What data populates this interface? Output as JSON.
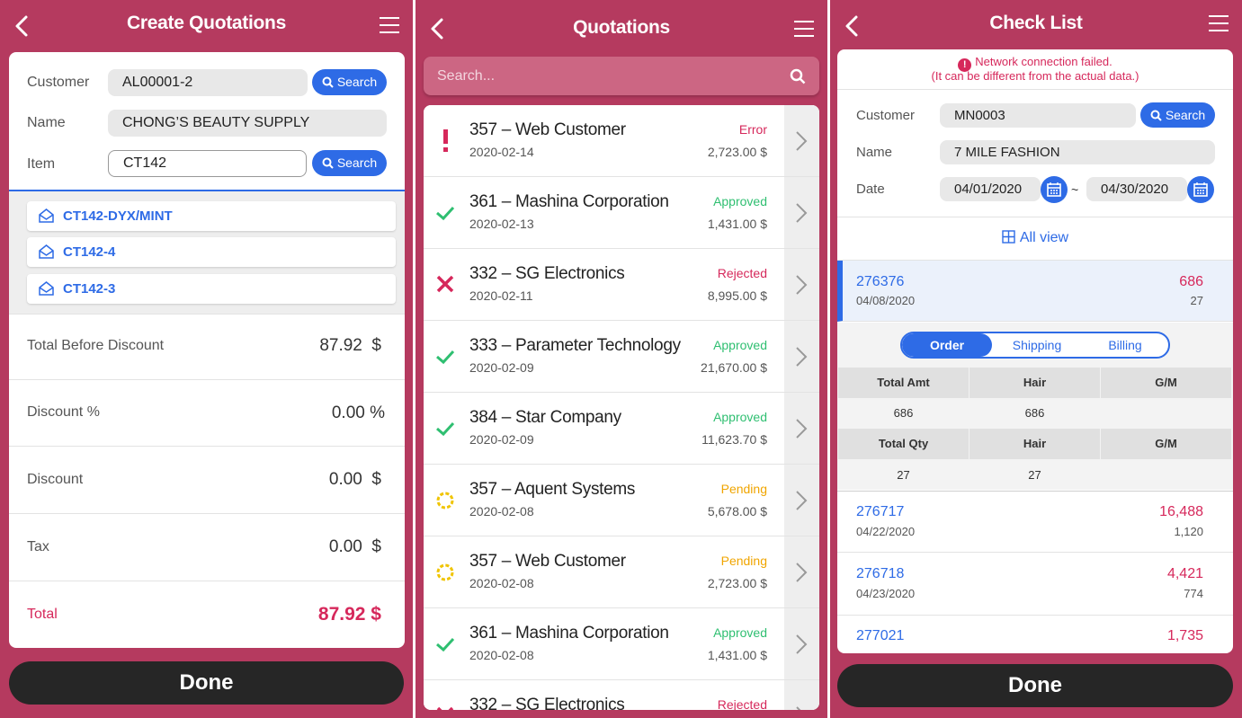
{
  "panel1": {
    "title": "Create Quotations",
    "customer_label": "Customer",
    "customer_value": "AL00001-2",
    "search_label": "Search",
    "name_label": "Name",
    "name_value": "CHONG’S BEAUTY SUPPLY",
    "item_label": "Item",
    "item_value": "CT142",
    "suggestions": [
      "CT142-DYX/MINT",
      "CT142-4",
      "CT142-3"
    ],
    "totals": [
      {
        "label": "Total Before Discount",
        "value": "87.92  $"
      },
      {
        "label": "Discount %",
        "value": "0.00 %"
      },
      {
        "label": "Discount",
        "value": "0.00  $"
      },
      {
        "label": "Tax",
        "value": "0.00  $"
      }
    ],
    "total_label": "Total",
    "total_value": "87.92 $",
    "done_label": "Done"
  },
  "panel2": {
    "title": "Quotations",
    "search_placeholder": "Search...",
    "items": [
      {
        "icon": "error-icon",
        "name": "357 – Web Customer",
        "date": "2020-02-14",
        "status": "Error",
        "amount": "2,723.00 $"
      },
      {
        "icon": "check-icon",
        "name": "361 – Mashina Corporation",
        "date": "2020-02-13",
        "status": "Approved",
        "amount": "1,431.00 $"
      },
      {
        "icon": "x-icon",
        "name": "332 – SG Electronics",
        "date": "2020-02-11",
        "status": "Rejected",
        "amount": "8,995.00 $"
      },
      {
        "icon": "check-icon",
        "name": "333 – Parameter Technology",
        "date": "2020-02-09",
        "status": "Approved",
        "amount": "21,670.00 $"
      },
      {
        "icon": "check-icon",
        "name": "384 – Star Company",
        "date": "2020-02-09",
        "status": "Approved",
        "amount": "11,623.70 $"
      },
      {
        "icon": "pending-icon",
        "name": "357 – Aquent Systems",
        "date": "2020-02-08",
        "status": "Pending",
        "amount": "5,678.00 $"
      },
      {
        "icon": "pending-icon",
        "name": "357 – Web Customer",
        "date": "2020-02-08",
        "status": "Pending",
        "amount": "2,723.00 $"
      },
      {
        "icon": "check-icon",
        "name": "361 – Mashina Corporation",
        "date": "2020-02-08",
        "status": "Approved",
        "amount": "1,431.00 $"
      },
      {
        "icon": "x-icon",
        "name": "332 – SG Electronics",
        "date": "",
        "status": "Rejected",
        "amount": ""
      }
    ],
    "status_colors": {
      "Error": "#d6285b",
      "Approved": "#2fbf71",
      "Rejected": "#d6285b",
      "Pending": "#f0a500"
    }
  },
  "panel3": {
    "title": "Check List",
    "error_line1": "Network connection failed.",
    "error_line2": "(It can be different from the actual data.)",
    "customer_label": "Customer",
    "customer_value": "MN0003",
    "search_label": "Search",
    "name_label": "Name",
    "name_value": "7 MILE FASHION",
    "date_label": "Date",
    "date_from": "04/01/2020",
    "date_sep": "~",
    "date_to": "04/30/2020",
    "all_view_label": "All view",
    "orders": [
      {
        "no": "276376",
        "date": "04/08/2020",
        "amount": "686",
        "qty": "27"
      },
      {
        "no": "276717",
        "date": "04/22/2020",
        "amount": "16,488",
        "qty": "1,120"
      },
      {
        "no": "276718",
        "date": "04/23/2020",
        "amount": "4,421",
        "qty": "774"
      },
      {
        "no": "277021",
        "date": "",
        "amount": "1,735",
        "qty": ""
      }
    ],
    "tabs": [
      "Order",
      "Shipping",
      "Billing"
    ],
    "detail": {
      "header1": [
        "Total Amt",
        "Hair",
        "G/M"
      ],
      "row1": [
        "686",
        "686",
        ""
      ],
      "header2": [
        "Total Qty",
        "Hair",
        "G/M"
      ],
      "row2": [
        "27",
        "27",
        ""
      ]
    },
    "done_label": "Done"
  },
  "colors": {
    "brand": "#b53a5f",
    "accent": "#2e6be6",
    "danger": "#d6285b",
    "dark": "#262626"
  }
}
